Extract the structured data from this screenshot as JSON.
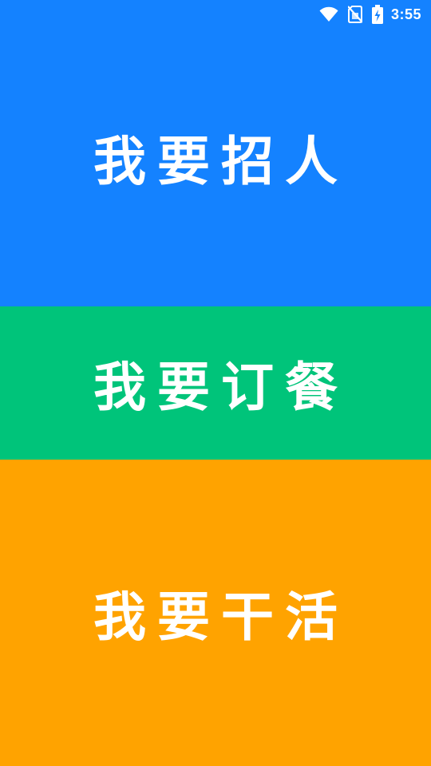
{
  "status_bar": {
    "time": "3:55",
    "icons": [
      "wifi-icon",
      "no-sim-icon",
      "battery-charging-icon"
    ]
  },
  "panels": [
    {
      "label": "我要招人",
      "color": "#1482FF"
    },
    {
      "label": "我要订餐",
      "color": "#00C47A"
    },
    {
      "label": "我要干活",
      "color": "#FFA300"
    }
  ]
}
